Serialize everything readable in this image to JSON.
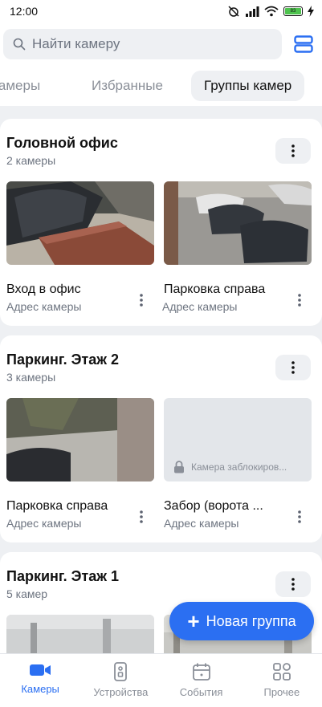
{
  "status_bar": {
    "time": "12:00",
    "battery_level": "83"
  },
  "search": {
    "placeholder": "Найти камеру"
  },
  "tabs": [
    {
      "label": "Камеры"
    },
    {
      "label": "Избранные"
    },
    {
      "label": "Группы камер",
      "active": true
    }
  ],
  "groups": [
    {
      "title": "Головной офис",
      "count": "2 камеры",
      "cameras": [
        {
          "name": "Вход в офис",
          "address": "Адрес камеры"
        },
        {
          "name": "Парковка справа",
          "address": "Адрес камеры"
        }
      ]
    },
    {
      "title": "Паркинг. Этаж 2",
      "count": "3 камеры",
      "cameras": [
        {
          "name": "Парковка справа",
          "address": "Адрес камеры"
        },
        {
          "name": "Забор (ворота ...",
          "address": "Адрес камеры",
          "locked_text": "Камера заблокиров..."
        }
      ]
    },
    {
      "title": "Паркинг. Этаж 1",
      "count": "5 камер"
    }
  ],
  "fab": {
    "label": "Новая группа"
  },
  "bottom_nav": [
    {
      "label": "Камеры",
      "icon": "camera-icon",
      "active": true
    },
    {
      "label": "Устройства",
      "icon": "remote-icon"
    },
    {
      "label": "События",
      "icon": "calendar-icon"
    },
    {
      "label": "Прочее",
      "icon": "grid-icon"
    }
  ],
  "colors": {
    "accent": "#2b6ff2",
    "background": "#eef0f3",
    "battery": "#4ec34e"
  }
}
